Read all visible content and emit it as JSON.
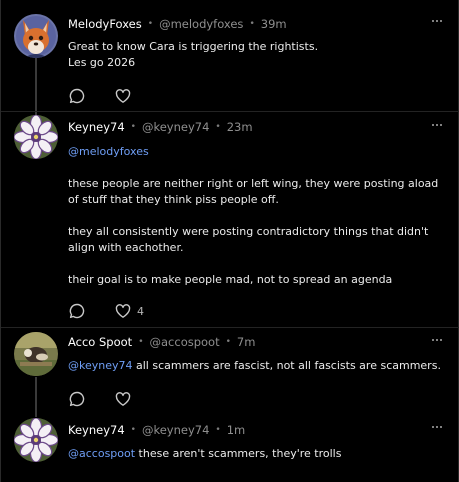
{
  "posts": [
    {
      "name": "MelodyFoxes",
      "handle": "@melodyfoxes",
      "time": "39m",
      "lines": [
        "Great to know Cara is triggering the rightists.",
        "Les go 2026"
      ],
      "likes": ""
    },
    {
      "name": "Keyney74",
      "handle": "@keyney74",
      "time": "23m",
      "mention": "@melodyfoxes",
      "paragraphs": [
        "these people are neither right or left wing, they were posting aload of stuff that they think piss people off.",
        "they all consistently were posting contradictory things that didn't align with eachother.",
        "their goal is to make people mad, not to spread an agenda"
      ],
      "likes": "4"
    },
    {
      "name": "Acco Spoot",
      "handle": "@accospoot",
      "time": "7m",
      "mention": "@keyney74",
      "text": " all scammers are fascist, not all fascists are scammers.",
      "likes": ""
    },
    {
      "name": "Keyney74",
      "handle": "@keyney74",
      "time": "1m",
      "mention": "@accospoot",
      "text": " these aren't scammers, they're trolls",
      "likes": ""
    }
  ],
  "separator": "•",
  "icons": {
    "reply": "speech-bubble-icon",
    "like": "heart-icon",
    "more": "ellipsis-icon"
  },
  "colors": {
    "background": "#000000",
    "mention": "#6f9ef5",
    "muted": "#8f8f8f",
    "thread_line": "#3a3a3a"
  }
}
